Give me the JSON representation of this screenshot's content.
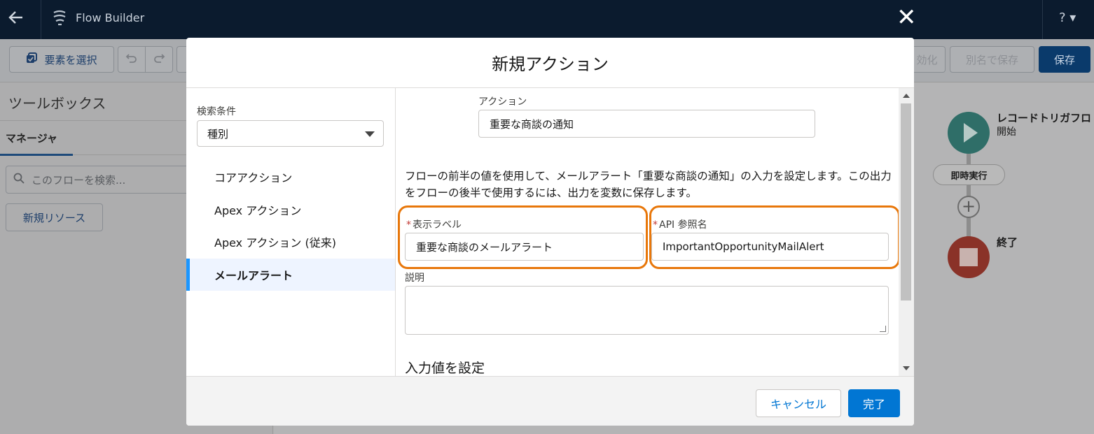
{
  "app": {
    "title": "Flow Builder",
    "help_label": "? ▾"
  },
  "toolbar": {
    "select_elements": "要素を選択",
    "undo_icon": "undo-icon",
    "redo_icon": "redo-icon",
    "activate_label": "効化",
    "save_as_label": "別名で保存",
    "save_label": "保存"
  },
  "sidebar": {
    "title": "ツールボックス",
    "tab_manager": "マネージャ",
    "search_placeholder": "このフローを検索...",
    "new_resource": "新規リソース"
  },
  "canvas": {
    "start_title": "レコードトリガフロ",
    "start_sub": "開始",
    "immediate": "即時実行",
    "end_title": "終了"
  },
  "modal": {
    "title": "新規アクション",
    "filter_label": "検索条件",
    "filter_value": "種別",
    "categories": [
      {
        "label": "コアアクション",
        "active": false
      },
      {
        "label": "Apex アクション",
        "active": false
      },
      {
        "label": "Apex アクション (従来)",
        "active": false
      },
      {
        "label": "メールアラート",
        "active": true
      }
    ],
    "action_label": "アクション",
    "action_value": "重要な商談の通知",
    "description": "フローの前半の値を使用して、メールアラート「重要な商談の通知」の入力を設定します。この出力をフローの後半で使用するには、出力を変数に保存します。",
    "display_label_label": "表示ラベル",
    "display_label_value": "重要な商談のメールアラート",
    "api_name_label": "API 参照名",
    "api_name_value": "ImportantOpportunityMailAlert",
    "description_field_label": "説明",
    "description_field_value": "",
    "section_input": "入力値を設定",
    "cancel": "キャンセル",
    "done": "完了"
  },
  "colors": {
    "accent": "#0176d3",
    "highlight": "#e8770a",
    "required": "#c23934"
  }
}
